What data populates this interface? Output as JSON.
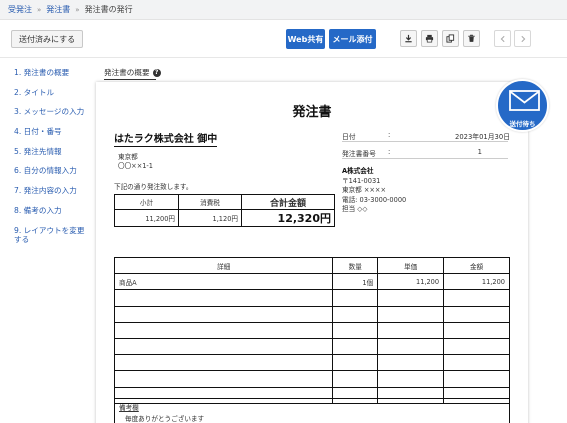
{
  "breadcrumb": {
    "item1": "受発注",
    "item2": "発注書",
    "current": "発注書の発行"
  },
  "toolbar": {
    "mark_sent_label": "送付済みにする",
    "web_share_label": "Web共有",
    "mail_attach_label": "メール添付"
  },
  "icons": {
    "download": "download-icon",
    "print": "print-icon",
    "copy": "copy-icon",
    "delete": "trash-icon",
    "prev": "chevron-left-icon",
    "next": "chevron-right-icon",
    "mail": "envelope-icon"
  },
  "sidebar": {
    "items": [
      {
        "label": "1. 発注書の概要"
      },
      {
        "label": "2. タイトル"
      },
      {
        "label": "3. メッセージの入力"
      },
      {
        "label": "4. 日付・番号"
      },
      {
        "label": "5. 発注先情報"
      },
      {
        "label": "6. 自分の情報入力"
      },
      {
        "label": "7. 発注内容の入力"
      },
      {
        "label": "8. 備考の入力"
      },
      {
        "label": "9. レイアウトを変更する"
      }
    ]
  },
  "tab": {
    "label": "発注書の概要",
    "help": "?"
  },
  "document": {
    "title": "発注書",
    "recipient": "はたラク株式会社 御中",
    "recipient_address": {
      "line1": "東京都",
      "line2": "〇〇××1-1"
    },
    "intro": "下記の通り発注致します。",
    "summary": {
      "subtotal_label": "小計",
      "tax_label": "消費税",
      "total_label": "合計金額",
      "subtotal": "11,200円",
      "tax": "1,120円",
      "total": "12,320円"
    },
    "meta": {
      "date_label": "日付",
      "date_colon": ":",
      "date_value": "2023年01月30日",
      "number_label": "発注書番号",
      "number_colon": ":",
      "number_value": "1"
    },
    "sender": {
      "company": "A株式会社",
      "postal": "〒141-0031",
      "address": "東京都 ××××",
      "phone": "電話: 03-3000-0000",
      "person": "担当 ◇◇"
    },
    "items": {
      "headers": {
        "detail": "詳細",
        "qty": "数量",
        "unit_price": "単価",
        "amount": "金額"
      },
      "row1": {
        "detail": "商品A",
        "qty": "1個",
        "unit_price": "11,200",
        "amount": "11,200"
      }
    },
    "remarks": {
      "label": "備考欄",
      "text": "毎度ありがとうございます"
    }
  },
  "status_badge": {
    "label": "送付待ち"
  },
  "colors": {
    "accent": "#2569c7",
    "link": "#2a5db0"
  }
}
